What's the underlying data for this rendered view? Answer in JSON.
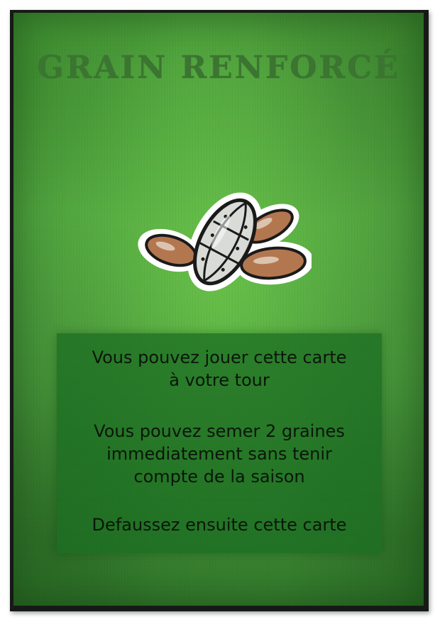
{
  "card": {
    "title": "GRAIN RENFORCÉ",
    "illustration_icon": "armored-seed-icon",
    "paragraphs": {
      "p1_line1": "Vous pouvez jouer cette carte",
      "p1_line2": "à votre tour",
      "p2_line1": "Vous pouvez semer 2 graines",
      "p2_line2": "immediatement sans tenir",
      "p2_line3": "compte de la saison",
      "p3_line1": "Defaussez ensuite cette carte"
    }
  },
  "colors": {
    "card_green": "#56ad45",
    "title_green": "#3c7432",
    "panel_green": "#1c6e23",
    "text_dark": "#0b160a",
    "frame_dark": "#161a16"
  }
}
